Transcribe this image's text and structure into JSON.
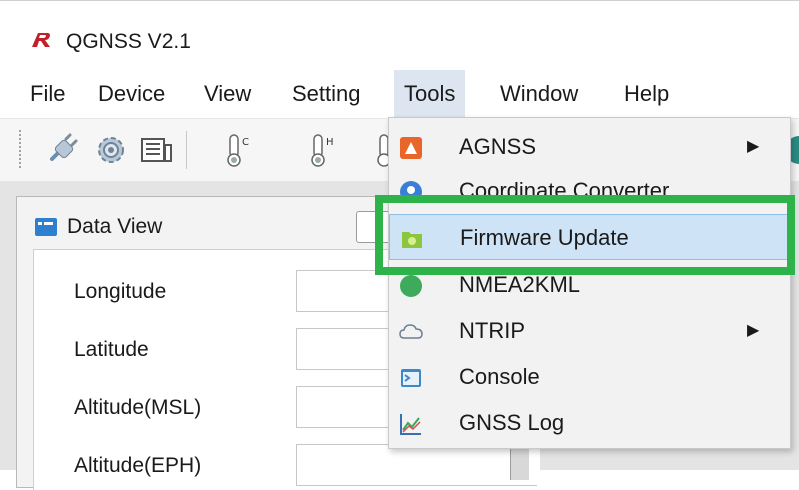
{
  "window": {
    "title": "QGNSS V2.1"
  },
  "menubar": {
    "items": [
      "File",
      "Device",
      "View",
      "Setting",
      "Tools",
      "Window",
      "Help"
    ]
  },
  "data_view": {
    "title": "Data View",
    "fields": [
      "Longitude",
      "Latitude",
      "Altitude(MSL)",
      "Altitude(EPH)"
    ]
  },
  "tools_menu": {
    "items": [
      {
        "label": "AGNSS",
        "icon": "agnss-icon",
        "submenu": true
      },
      {
        "label": "Coordinate Converter",
        "icon": "coordinate-icon",
        "submenu": false
      },
      {
        "label": "Firmware Update",
        "icon": "firmware-icon",
        "submenu": false
      },
      {
        "label": "NMEA2KML",
        "icon": "nmea-icon",
        "submenu": false
      },
      {
        "label": "NTRIP",
        "icon": "cloud-icon",
        "submenu": true
      },
      {
        "label": "Console",
        "icon": "console-icon",
        "submenu": false
      },
      {
        "label": "GNSS Log",
        "icon": "chart-icon",
        "submenu": false
      }
    ],
    "highlighted": "Firmware Update",
    "highlight_color": "#2db34a"
  },
  "colors": {
    "accent": "#2db34a",
    "hover": "#cfe3f7"
  }
}
